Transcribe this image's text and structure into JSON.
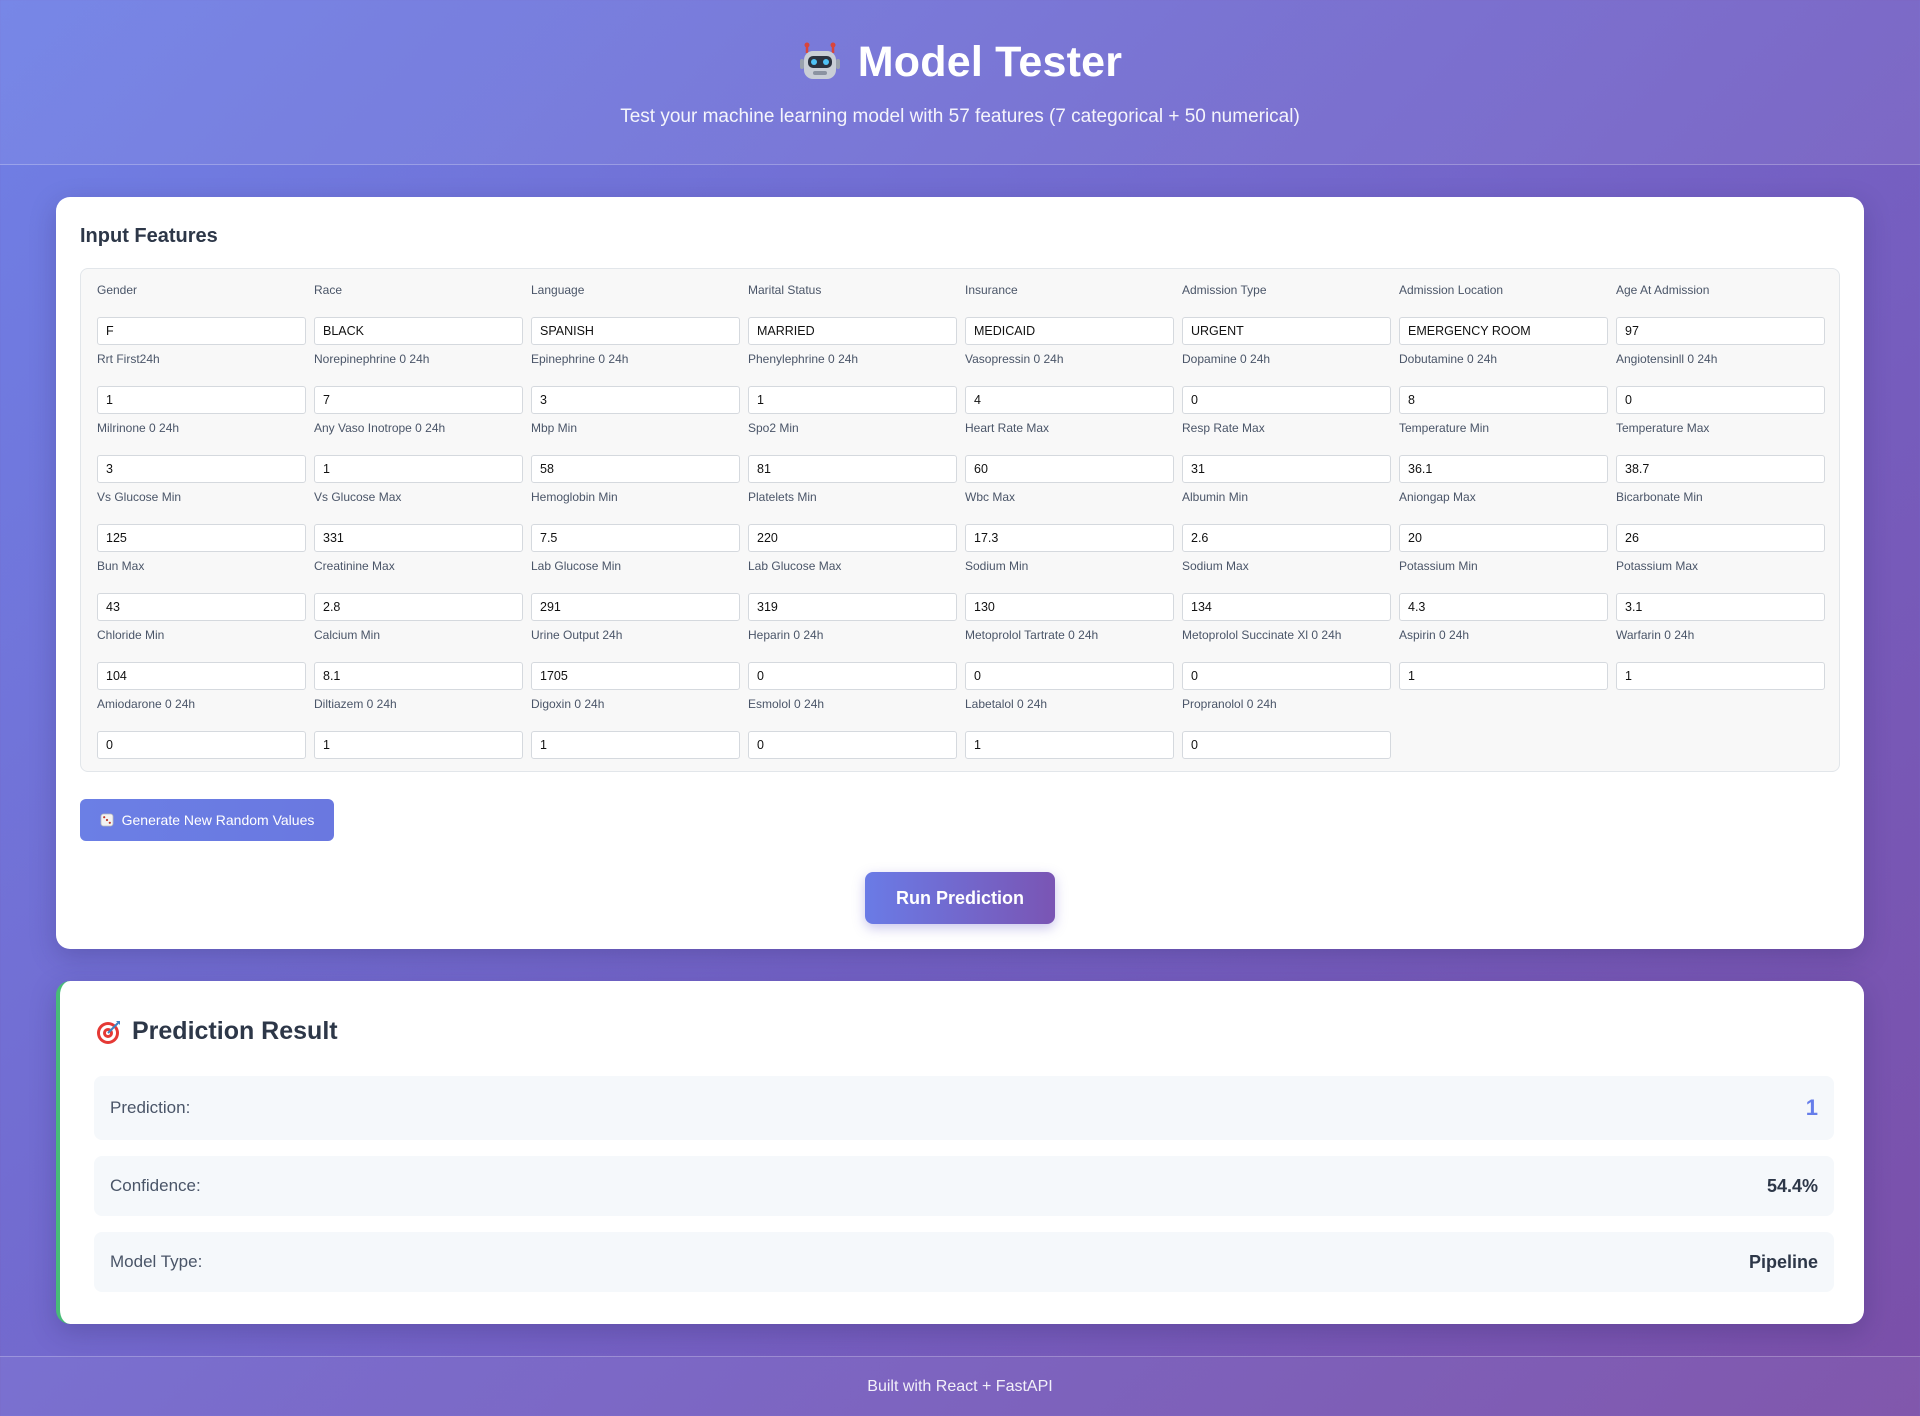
{
  "header": {
    "title": "Model Tester",
    "subtitle": "Test your machine learning model with 57 features (7 categorical + 50 numerical)",
    "icon": "robot-icon"
  },
  "input_section": {
    "heading": "Input Features",
    "fields": [
      {
        "label": "Gender",
        "value": "F"
      },
      {
        "label": "Race",
        "value": "BLACK"
      },
      {
        "label": "Language",
        "value": "SPANISH"
      },
      {
        "label": "Marital Status",
        "value": "MARRIED"
      },
      {
        "label": "Insurance",
        "value": "MEDICAID"
      },
      {
        "label": "Admission Type",
        "value": "URGENT"
      },
      {
        "label": "Admission Location",
        "value": "EMERGENCY ROOM"
      },
      {
        "label": "Age At Admission",
        "value": "97"
      },
      {
        "label": "Rrt First24h",
        "value": "1"
      },
      {
        "label": "Norepinephrine 0 24h",
        "value": "7"
      },
      {
        "label": "Epinephrine 0 24h",
        "value": "3"
      },
      {
        "label": "Phenylephrine 0 24h",
        "value": "1"
      },
      {
        "label": "Vasopressin 0 24h",
        "value": "4"
      },
      {
        "label": "Dopamine 0 24h",
        "value": "0"
      },
      {
        "label": "Dobutamine 0 24h",
        "value": "8"
      },
      {
        "label": "Angiotensinll 0 24h",
        "value": "0"
      },
      {
        "label": "Milrinone 0 24h",
        "value": "3"
      },
      {
        "label": "Any Vaso Inotrope 0 24h",
        "value": "1"
      },
      {
        "label": "Mbp Min",
        "value": "58"
      },
      {
        "label": "Spo2 Min",
        "value": "81"
      },
      {
        "label": "Heart Rate Max",
        "value": "60"
      },
      {
        "label": "Resp Rate Max",
        "value": "31"
      },
      {
        "label": "Temperature Min",
        "value": "36.1"
      },
      {
        "label": "Temperature Max",
        "value": "38.7"
      },
      {
        "label": "Vs Glucose Min",
        "value": "125"
      },
      {
        "label": "Vs Glucose Max",
        "value": "331"
      },
      {
        "label": "Hemoglobin Min",
        "value": "7.5"
      },
      {
        "label": "Platelets Min",
        "value": "220"
      },
      {
        "label": "Wbc Max",
        "value": "17.3"
      },
      {
        "label": "Albumin Min",
        "value": "2.6"
      },
      {
        "label": "Aniongap Max",
        "value": "20"
      },
      {
        "label": "Bicarbonate Min",
        "value": "26"
      },
      {
        "label": "Bun Max",
        "value": "43"
      },
      {
        "label": "Creatinine Max",
        "value": "2.8"
      },
      {
        "label": "Lab Glucose Min",
        "value": "291"
      },
      {
        "label": "Lab Glucose Max",
        "value": "319"
      },
      {
        "label": "Sodium Min",
        "value": "130"
      },
      {
        "label": "Sodium Max",
        "value": "134"
      },
      {
        "label": "Potassium Min",
        "value": "4.3"
      },
      {
        "label": "Potassium Max",
        "value": "3.1"
      },
      {
        "label": "Chloride Min",
        "value": "104"
      },
      {
        "label": "Calcium Min",
        "value": "8.1"
      },
      {
        "label": "Urine Output 24h",
        "value": "1705"
      },
      {
        "label": "Heparin 0 24h",
        "value": "0"
      },
      {
        "label": "Metoprolol Tartrate 0 24h",
        "value": "0"
      },
      {
        "label": "Metoprolol Succinate Xl 0 24h",
        "value": "0"
      },
      {
        "label": "Aspirin 0 24h",
        "value": "1"
      },
      {
        "label": "Warfarin 0 24h",
        "value": "1"
      },
      {
        "label": "Amiodarone 0 24h",
        "value": "0"
      },
      {
        "label": "Diltiazem 0 24h",
        "value": "1"
      },
      {
        "label": "Digoxin 0 24h",
        "value": "1"
      },
      {
        "label": "Esmolol 0 24h",
        "value": "0"
      },
      {
        "label": "Labetalol 0 24h",
        "value": "1"
      },
      {
        "label": "Propranolol 0 24h",
        "value": "0"
      }
    ],
    "random_button_label": "Generate New Random Values",
    "random_button_icon": "dice-icon",
    "run_button_label": "Run Prediction"
  },
  "result": {
    "heading": "Prediction Result",
    "icon": "target-icon",
    "rows": [
      {
        "label": "Prediction:",
        "value": "1"
      },
      {
        "label": "Confidence:",
        "value": "54.4%"
      },
      {
        "label": "Model Type:",
        "value": "Pipeline"
      }
    ]
  },
  "footer": {
    "text": "Built with React + FastAPI"
  },
  "colors": {
    "accent": "#667eea",
    "success_border": "#48bb78",
    "gradient_start": "#6f80e6",
    "gradient_end": "#7b4fa8"
  }
}
